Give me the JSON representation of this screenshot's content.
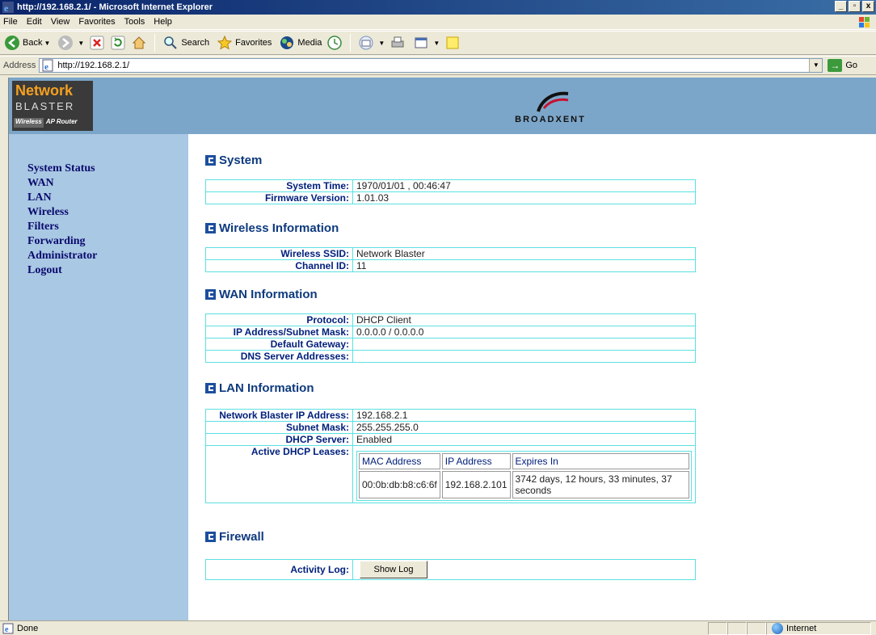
{
  "window": {
    "title": "http://192.168.2.1/ - Microsoft Internet Explorer"
  },
  "menu": [
    "File",
    "Edit",
    "View",
    "Favorites",
    "Tools",
    "Help"
  ],
  "toolbar": {
    "back": "Back",
    "search": "Search",
    "favorites": "Favorites",
    "media": "Media"
  },
  "address": {
    "label": "Address",
    "url": "http://192.168.2.1/",
    "go": "Go"
  },
  "banner": {
    "logo_line1": "Network",
    "logo_line2": "BLASTER",
    "logo_wireless": "Wireless",
    "logo_ap": "AP Router",
    "brand": "BROADXENT"
  },
  "nav": [
    "System Status",
    "WAN",
    "LAN",
    "Wireless",
    "Filters",
    "Forwarding",
    "Administrator",
    "Logout"
  ],
  "system": {
    "title": "System",
    "rows": [
      {
        "label": "System Time:",
        "value": "1970/01/01 , 00:46:47"
      },
      {
        "label": "Firmware Version:",
        "value": "1.01.03"
      }
    ]
  },
  "wireless": {
    "title": "Wireless Information",
    "rows": [
      {
        "label": "Wireless SSID:",
        "value": "Network Blaster"
      },
      {
        "label": "Channel ID:",
        "value": "11"
      }
    ]
  },
  "wan": {
    "title": "WAN Information",
    "rows": [
      {
        "label": "Protocol:",
        "value": "DHCP Client"
      },
      {
        "label": "IP Address/Subnet Mask:",
        "value": "0.0.0.0 / 0.0.0.0"
      },
      {
        "label": "Default Gateway:",
        "value": ""
      },
      {
        "label": "DNS Server Addresses:",
        "value": ""
      }
    ]
  },
  "lan": {
    "title": "LAN Information",
    "rows": [
      {
        "label": "Network Blaster IP Address:",
        "value": "192.168.2.1"
      },
      {
        "label": "Subnet Mask:",
        "value": "255.255.255.0"
      },
      {
        "label": "DHCP Server:",
        "value": "Enabled"
      },
      {
        "label": "Active DHCP Leases:",
        "value": ""
      }
    ],
    "leases": {
      "headers": [
        "MAC Address",
        "IP Address",
        "Expires In"
      ],
      "rows": [
        [
          "00:0b:db:b8:c6:6f",
          "192.168.2.101",
          "3742 days, 12 hours, 33 minutes, 37 seconds"
        ]
      ]
    }
  },
  "firewall": {
    "title": "Firewall",
    "activity_label": "Activity Log:",
    "show_log": "Show Log"
  },
  "status": {
    "text": "Done",
    "zone": "Internet"
  }
}
